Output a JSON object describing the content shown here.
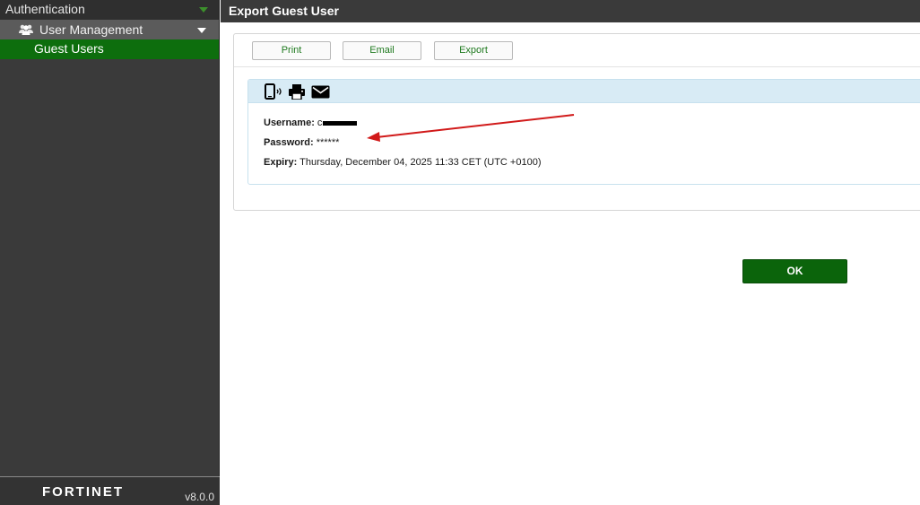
{
  "sidebar": {
    "section": "Authentication",
    "group": "User Management",
    "active_item": "Guest Users",
    "footer": {
      "logo_text": "FORTINET",
      "version": "v8.0.0"
    }
  },
  "dialog": {
    "title": "Export Guest User",
    "toolbar": {
      "print": "Print",
      "email": "Email",
      "export": "Export"
    },
    "card_icons": [
      "mobile-sms-icon",
      "printer-icon",
      "envelope-icon"
    ],
    "fields": {
      "username_label": "Username:",
      "username_value": "c",
      "password_label": "Password:",
      "password_value": "******",
      "expiry_label": "Expiry:",
      "expiry_value": "Thursday, December 04, 2025 11:33 CET (UTC +0100)"
    },
    "ok_label": "OK"
  },
  "colors": {
    "sidebar_bg": "#3a3a3a",
    "active_green": "#0d6e0d",
    "ok_green": "#0b640b",
    "annotation_red": "#d11a1a"
  }
}
